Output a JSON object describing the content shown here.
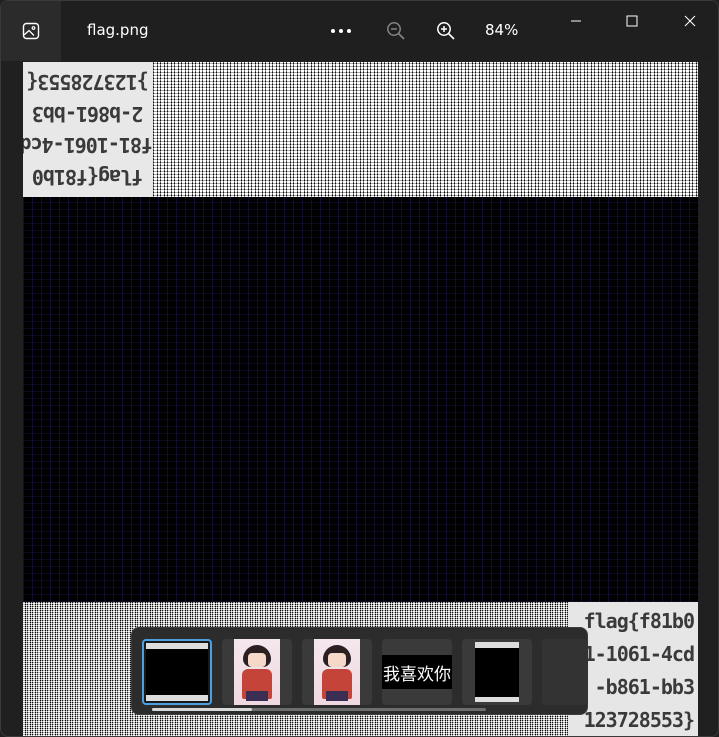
{
  "window": {
    "filename": "flag.png",
    "zoom": "84%"
  },
  "toolbar": {
    "more_icon": "more-icon",
    "zoom_out_icon": "zoom-out-icon",
    "zoom_in_icon": "zoom-in-icon"
  },
  "image": {
    "mirrored_text_lines": [
      "}123728553{",
      "2-b861-bb3",
      "f81-1061-4cd",
      "flag{f81b0"
    ],
    "corner_text_lines": [
      "flag{f81b0",
      "1-1061-4cd",
      "-b861-bb3",
      "123728553}"
    ]
  },
  "filmstrip": {
    "thumbnails": [
      {
        "name": "flag-thumbnail",
        "selected": true
      },
      {
        "name": "anime-girl-thumbnail-1",
        "selected": false
      },
      {
        "name": "anime-girl-thumbnail-2",
        "selected": false
      },
      {
        "name": "text-thumbnail",
        "label": "我喜欢你",
        "selected": false
      },
      {
        "name": "dark-image-thumbnail",
        "selected": false
      },
      {
        "name": "partial-thumbnail",
        "selected": false
      }
    ],
    "scroll_position": 0.3
  }
}
